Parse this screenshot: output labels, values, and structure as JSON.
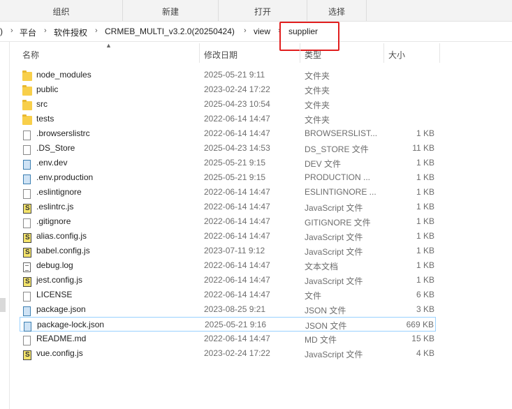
{
  "ribbon": {
    "groups": [
      "组织",
      "新建",
      "打开",
      "选择"
    ]
  },
  "breadcrumb": {
    "items": [
      "平台",
      "软件授权",
      "CRMEB_MULTI_v3.2.0(20250424)",
      "view",
      "supplier"
    ],
    "separator": "›",
    "leading_glyph": ")"
  },
  "columns": {
    "name": "名称",
    "date": "修改日期",
    "type": "类型",
    "size": "大小"
  },
  "files": [
    {
      "name": "node_modules",
      "date": "2025-05-21 9:11",
      "type": "文件夹",
      "size": "",
      "icon": "folder-icon"
    },
    {
      "name": "public",
      "date": "2023-02-24 17:22",
      "type": "文件夹",
      "size": "",
      "icon": "folder-icon"
    },
    {
      "name": "src",
      "date": "2025-04-23 10:54",
      "type": "文件夹",
      "size": "",
      "icon": "folder-icon"
    },
    {
      "name": "tests",
      "date": "2022-06-14 14:47",
      "type": "文件夹",
      "size": "",
      "icon": "folder-icon"
    },
    {
      "name": ".browserslistrc",
      "date": "2022-06-14 14:47",
      "type": "BROWSERSLIST...",
      "size": "1 KB",
      "icon": "file-icon"
    },
    {
      "name": ".DS_Store",
      "date": "2025-04-23 14:53",
      "type": "DS_STORE 文件",
      "size": "11 KB",
      "icon": "file-icon"
    },
    {
      "name": ".env.dev",
      "date": "2025-05-21 9:15",
      "type": "DEV 文件",
      "size": "1 KB",
      "icon": "document-icon"
    },
    {
      "name": ".env.production",
      "date": "2025-05-21 9:15",
      "type": "PRODUCTION ...",
      "size": "1 KB",
      "icon": "document-icon"
    },
    {
      "name": ".eslintignore",
      "date": "2022-06-14 14:47",
      "type": "ESLINTIGNORE ...",
      "size": "1 KB",
      "icon": "file-icon"
    },
    {
      "name": ".eslintrc.js",
      "date": "2022-06-14 14:47",
      "type": "JavaScript 文件",
      "size": "1 KB",
      "icon": "javascript-file-icon"
    },
    {
      "name": ".gitignore",
      "date": "2022-06-14 14:47",
      "type": "GITIGNORE 文件",
      "size": "1 KB",
      "icon": "file-icon"
    },
    {
      "name": "alias.config.js",
      "date": "2022-06-14 14:47",
      "type": "JavaScript 文件",
      "size": "1 KB",
      "icon": "javascript-file-icon"
    },
    {
      "name": "babel.config.js",
      "date": "2023-07-11 9:12",
      "type": "JavaScript 文件",
      "size": "1 KB",
      "icon": "javascript-file-icon"
    },
    {
      "name": "debug.log",
      "date": "2022-06-14 14:47",
      "type": "文本文档",
      "size": "1 KB",
      "icon": "text-file-icon"
    },
    {
      "name": "jest.config.js",
      "date": "2022-06-14 14:47",
      "type": "JavaScript 文件",
      "size": "1 KB",
      "icon": "javascript-file-icon"
    },
    {
      "name": "LICENSE",
      "date": "2022-06-14 14:47",
      "type": "文件",
      "size": "6 KB",
      "icon": "file-icon"
    },
    {
      "name": "package.json",
      "date": "2023-08-25 9:21",
      "type": "JSON 文件",
      "size": "3 KB",
      "icon": "document-icon"
    },
    {
      "name": "package-lock.json",
      "date": "2025-05-21 9:16",
      "type": "JSON 文件",
      "size": "669 KB",
      "icon": "document-icon",
      "selected": true
    },
    {
      "name": "README.md",
      "date": "2022-06-14 14:47",
      "type": "MD 文件",
      "size": "15 KB",
      "icon": "file-icon"
    },
    {
      "name": "vue.config.js",
      "date": "2023-02-24 17:22",
      "type": "JavaScript 文件",
      "size": "4 KB",
      "icon": "javascript-file-icon"
    }
  ],
  "colors": {
    "highlight_box": "#e11e1e",
    "selection_border": "#99d1ff",
    "folder": "#f8cf4a"
  }
}
